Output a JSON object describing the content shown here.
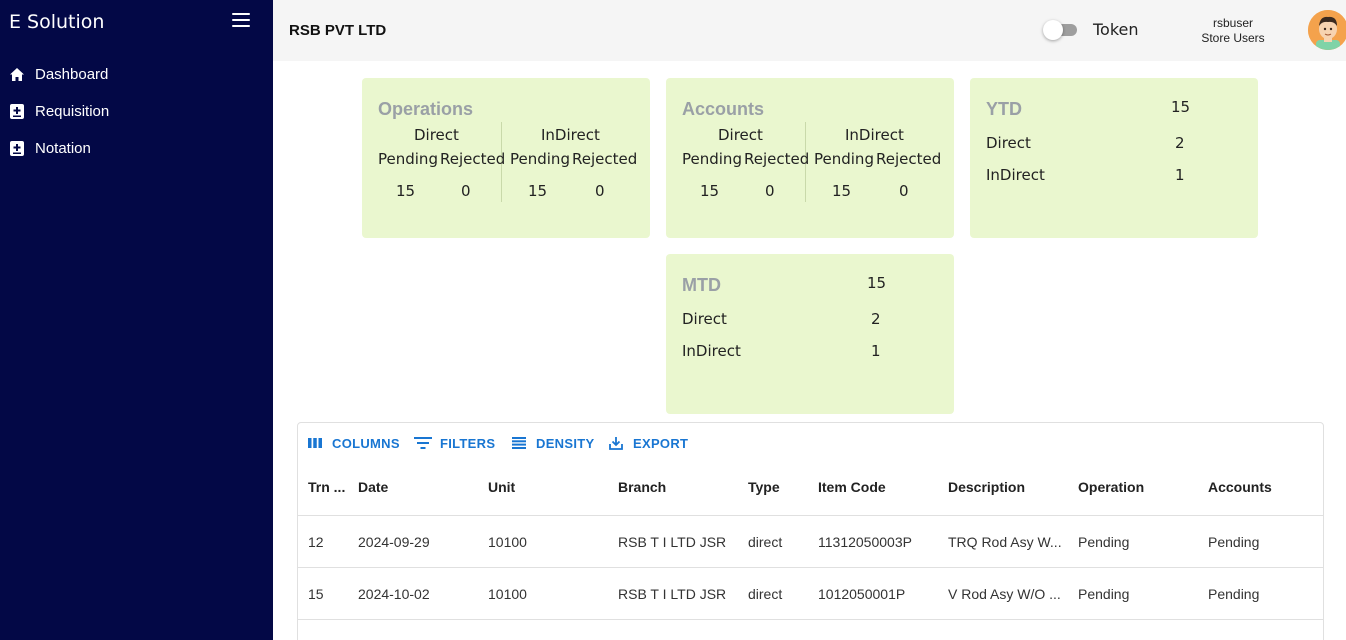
{
  "sidebar": {
    "brand": "E Solution",
    "items": [
      {
        "label": "Dashboard",
        "icon": "home-icon"
      },
      {
        "label": "Requisition",
        "icon": "add-box-icon"
      },
      {
        "label": "Notation",
        "icon": "add-box-icon"
      }
    ]
  },
  "header": {
    "company": "RSB PVT LTD",
    "token_label": "Token",
    "token_enabled": false,
    "user_name": "rsbuser",
    "user_role": "Store Users"
  },
  "cards": {
    "operations": {
      "title": "Operations",
      "direct_label": "Direct",
      "indirect_label": "InDirect",
      "pending_label": "Pending",
      "rejected_label": "Rejected",
      "direct_pending": "15",
      "direct_rejected": "0",
      "indirect_pending": "15",
      "indirect_rejected": "0"
    },
    "accounts": {
      "title": "Accounts",
      "direct_label": "Direct",
      "indirect_label": "InDirect",
      "pending_label": "Pending",
      "rejected_label": "Rejected",
      "direct_pending": "15",
      "direct_rejected": "0",
      "indirect_pending": "15",
      "indirect_rejected": "0"
    },
    "ytd": {
      "title": "YTD",
      "total": "15",
      "direct_label": "Direct",
      "direct": "2",
      "indirect_label": "InDirect",
      "indirect": "1"
    },
    "mtd": {
      "title": "MTD",
      "total": "15",
      "direct_label": "Direct",
      "direct": "2",
      "indirect_label": "InDirect",
      "indirect": "1"
    }
  },
  "grid": {
    "toolbar": {
      "columns": "COLUMNS",
      "filters": "FILTERS",
      "density": "DENSITY",
      "export": "EXPORT"
    },
    "columns": [
      "Trn ...",
      "Date",
      "Unit",
      "Branch",
      "Type",
      "Item Code",
      "Description",
      "Operation",
      "Accounts"
    ],
    "rows": [
      [
        "12",
        "2024-09-29",
        "10100",
        "RSB T I LTD JSR",
        "direct",
        "11312050003P",
        "TRQ Rod Asy W...",
        "Pending",
        "Pending"
      ],
      [
        "15",
        "2024-10-02",
        "10100",
        "RSB T I LTD JSR",
        "direct",
        "1012050001P",
        "V Rod Asy W/O ...",
        "Pending",
        "Pending"
      ]
    ]
  },
  "colors": {
    "sidebar_bg": "#030846",
    "card_bg": "#eaf7cf",
    "accent": "#1976d2"
  }
}
